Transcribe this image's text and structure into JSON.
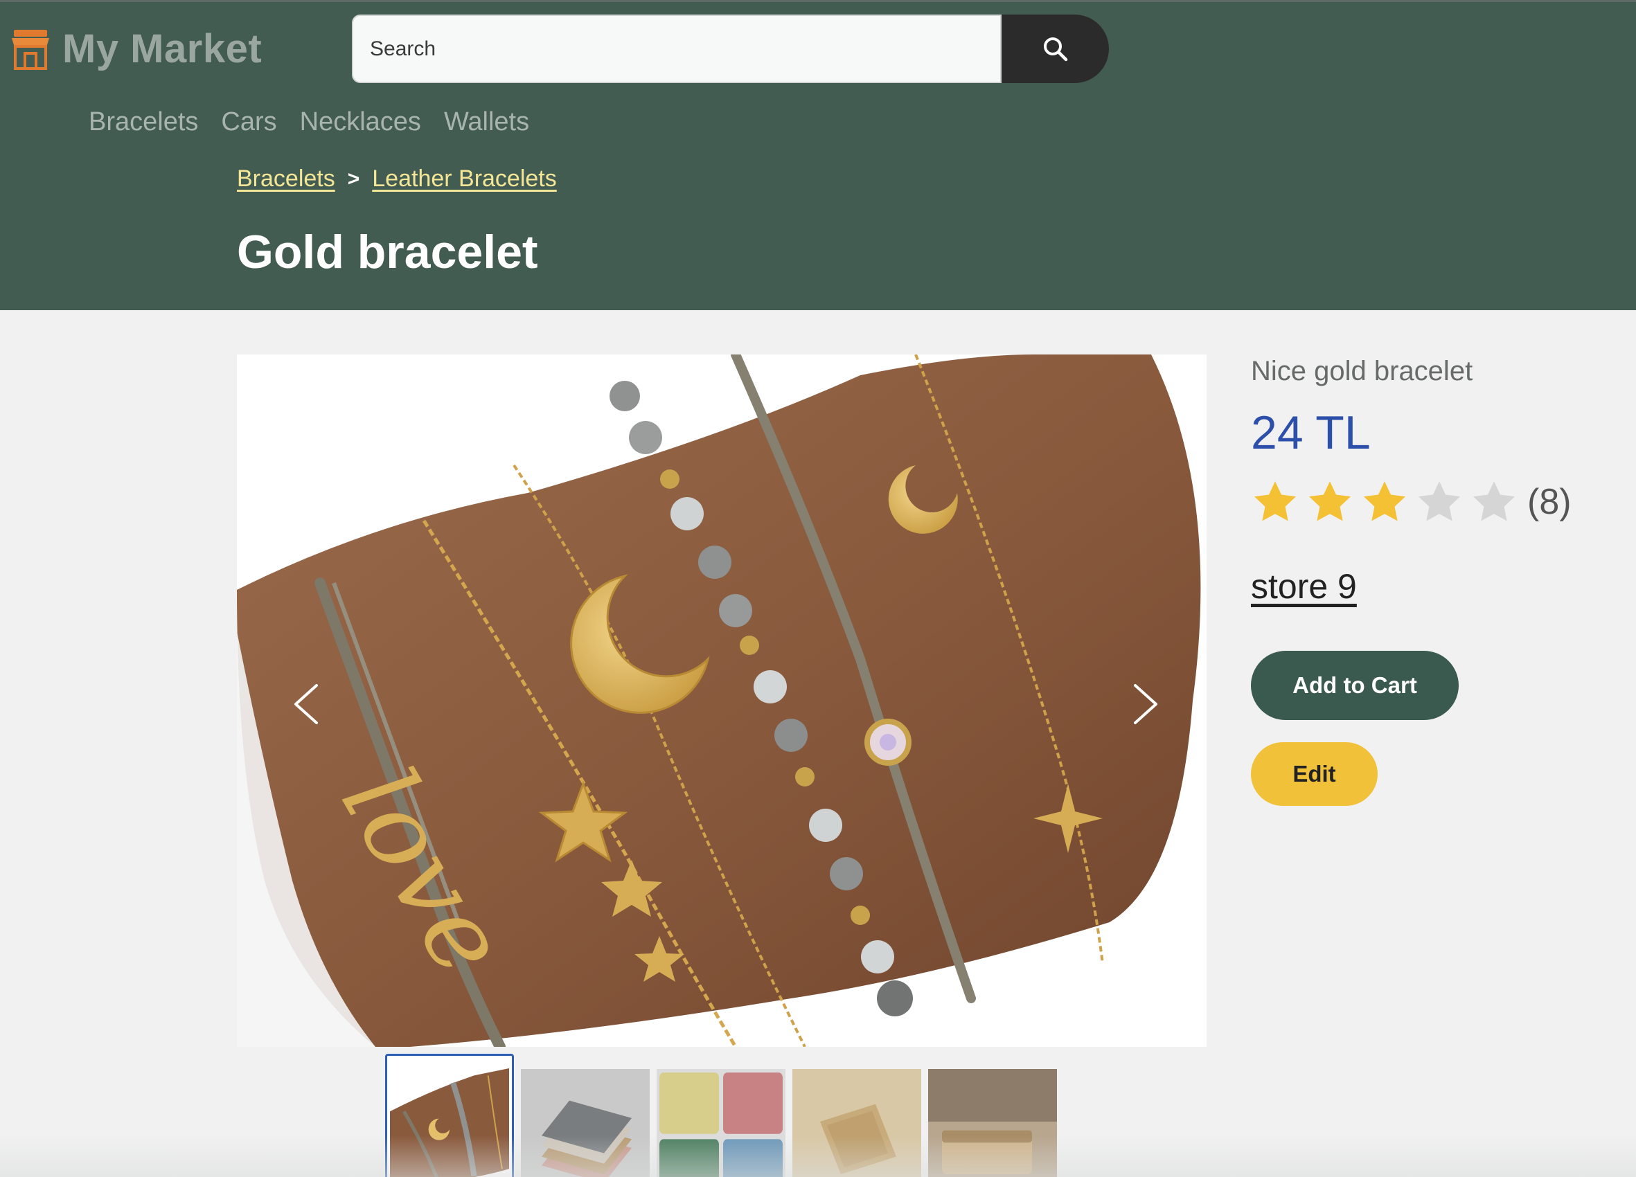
{
  "header": {
    "brand": "My Market",
    "search": {
      "placeholder": "Search",
      "value": ""
    },
    "nav": [
      "Bracelets",
      "Cars",
      "Necklaces",
      "Wallets"
    ]
  },
  "breadcrumb": {
    "items": [
      "Bracelets",
      "Leather Bracelets"
    ],
    "separator": ">"
  },
  "product": {
    "title": "Gold bracelet",
    "subtitle": "Nice gold bracelet",
    "price": "24 TL",
    "rating": 3,
    "rating_max": 5,
    "review_count": "(8)",
    "store": "store 9"
  },
  "actions": {
    "add_to_cart": "Add to Cart",
    "edit": "Edit"
  },
  "gallery": {
    "selected_index": 0,
    "thumbnails": [
      "bracelets-photo",
      "stacked-wallets-photo",
      "card-holders-photo",
      "leather-wallet-photo",
      "wallet-on-table-photo"
    ]
  },
  "colors": {
    "header_bg": "#435c51",
    "price": "#2c4fa9",
    "breadcrumb_link": "#f3e697",
    "star_filled": "#f4c135",
    "star_empty": "#d5d5d5",
    "cart_button": "#3b5a4f",
    "edit_button": "#f2c13a"
  }
}
